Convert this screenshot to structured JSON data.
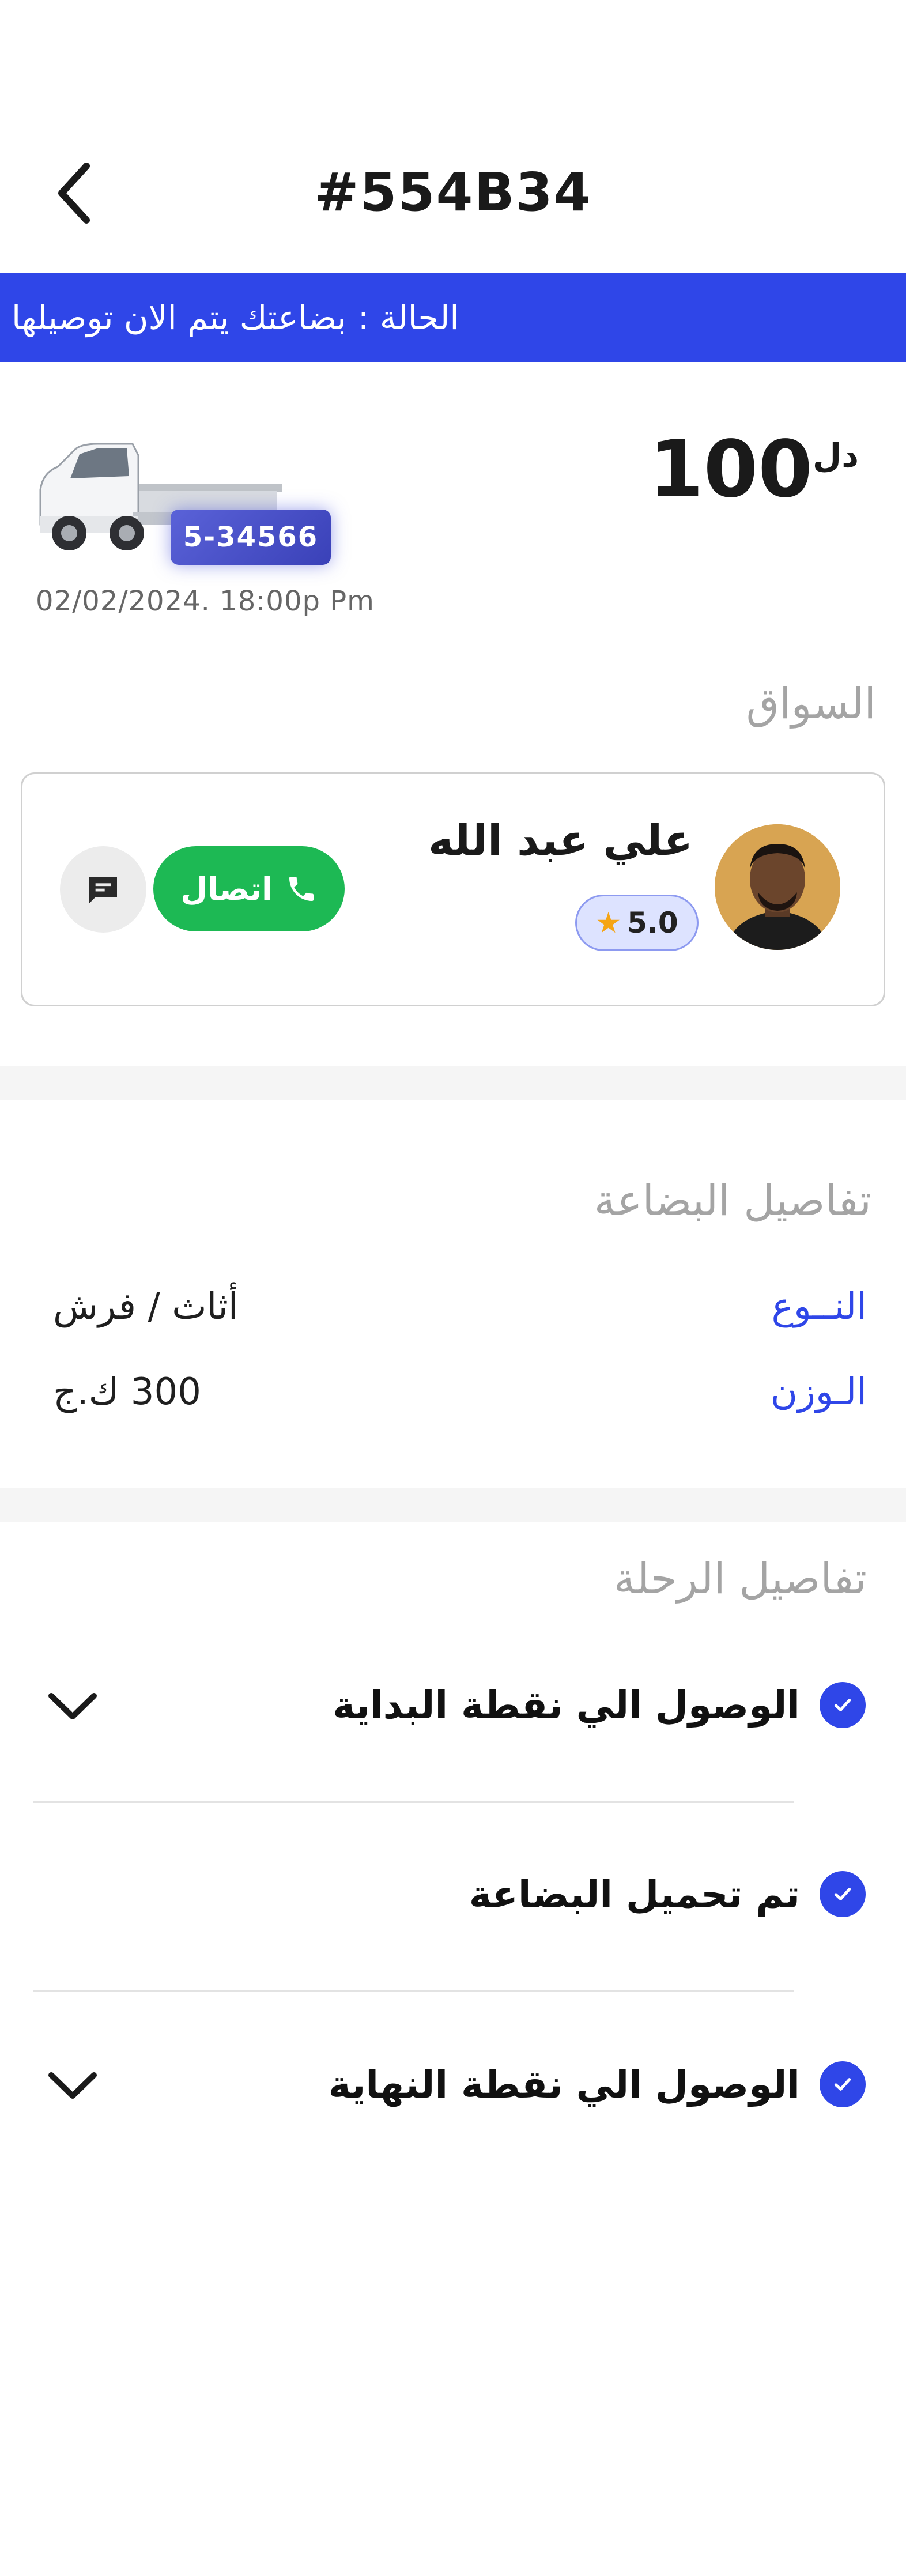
{
  "header": {
    "title": "#554B34"
  },
  "status": {
    "label": "الحالة :",
    "value": "بضاعتك يتم الان توصيلها"
  },
  "order": {
    "price": "100",
    "currency": "دل",
    "plate": "5-34566",
    "datetime": "02/02/2024. 18:00p Pm"
  },
  "driver": {
    "section_title": "السواق",
    "name": "علي عبد الله",
    "rating": "5.0",
    "call_label": "اتصال"
  },
  "cargo": {
    "section_title": "تفاصيل البضاعة",
    "rows": [
      {
        "label": "النــوع",
        "value": "أثاث / فرش"
      },
      {
        "label": "الـوزن",
        "value": "300 ك.ج"
      }
    ]
  },
  "trip": {
    "section_title": "تفاصيل الرحلة",
    "steps": [
      {
        "label": "الوصول الي نقطة البداية",
        "done": true,
        "expandable": true
      },
      {
        "label": "تم تحميل البضاعة",
        "done": true,
        "expandable": false
      },
      {
        "label": "الوصول الي نقطة النهاية",
        "done": true,
        "expandable": true
      }
    ]
  },
  "colors": {
    "accent": "#2f46e8",
    "call": "#1db954",
    "star": "#f5a516"
  }
}
